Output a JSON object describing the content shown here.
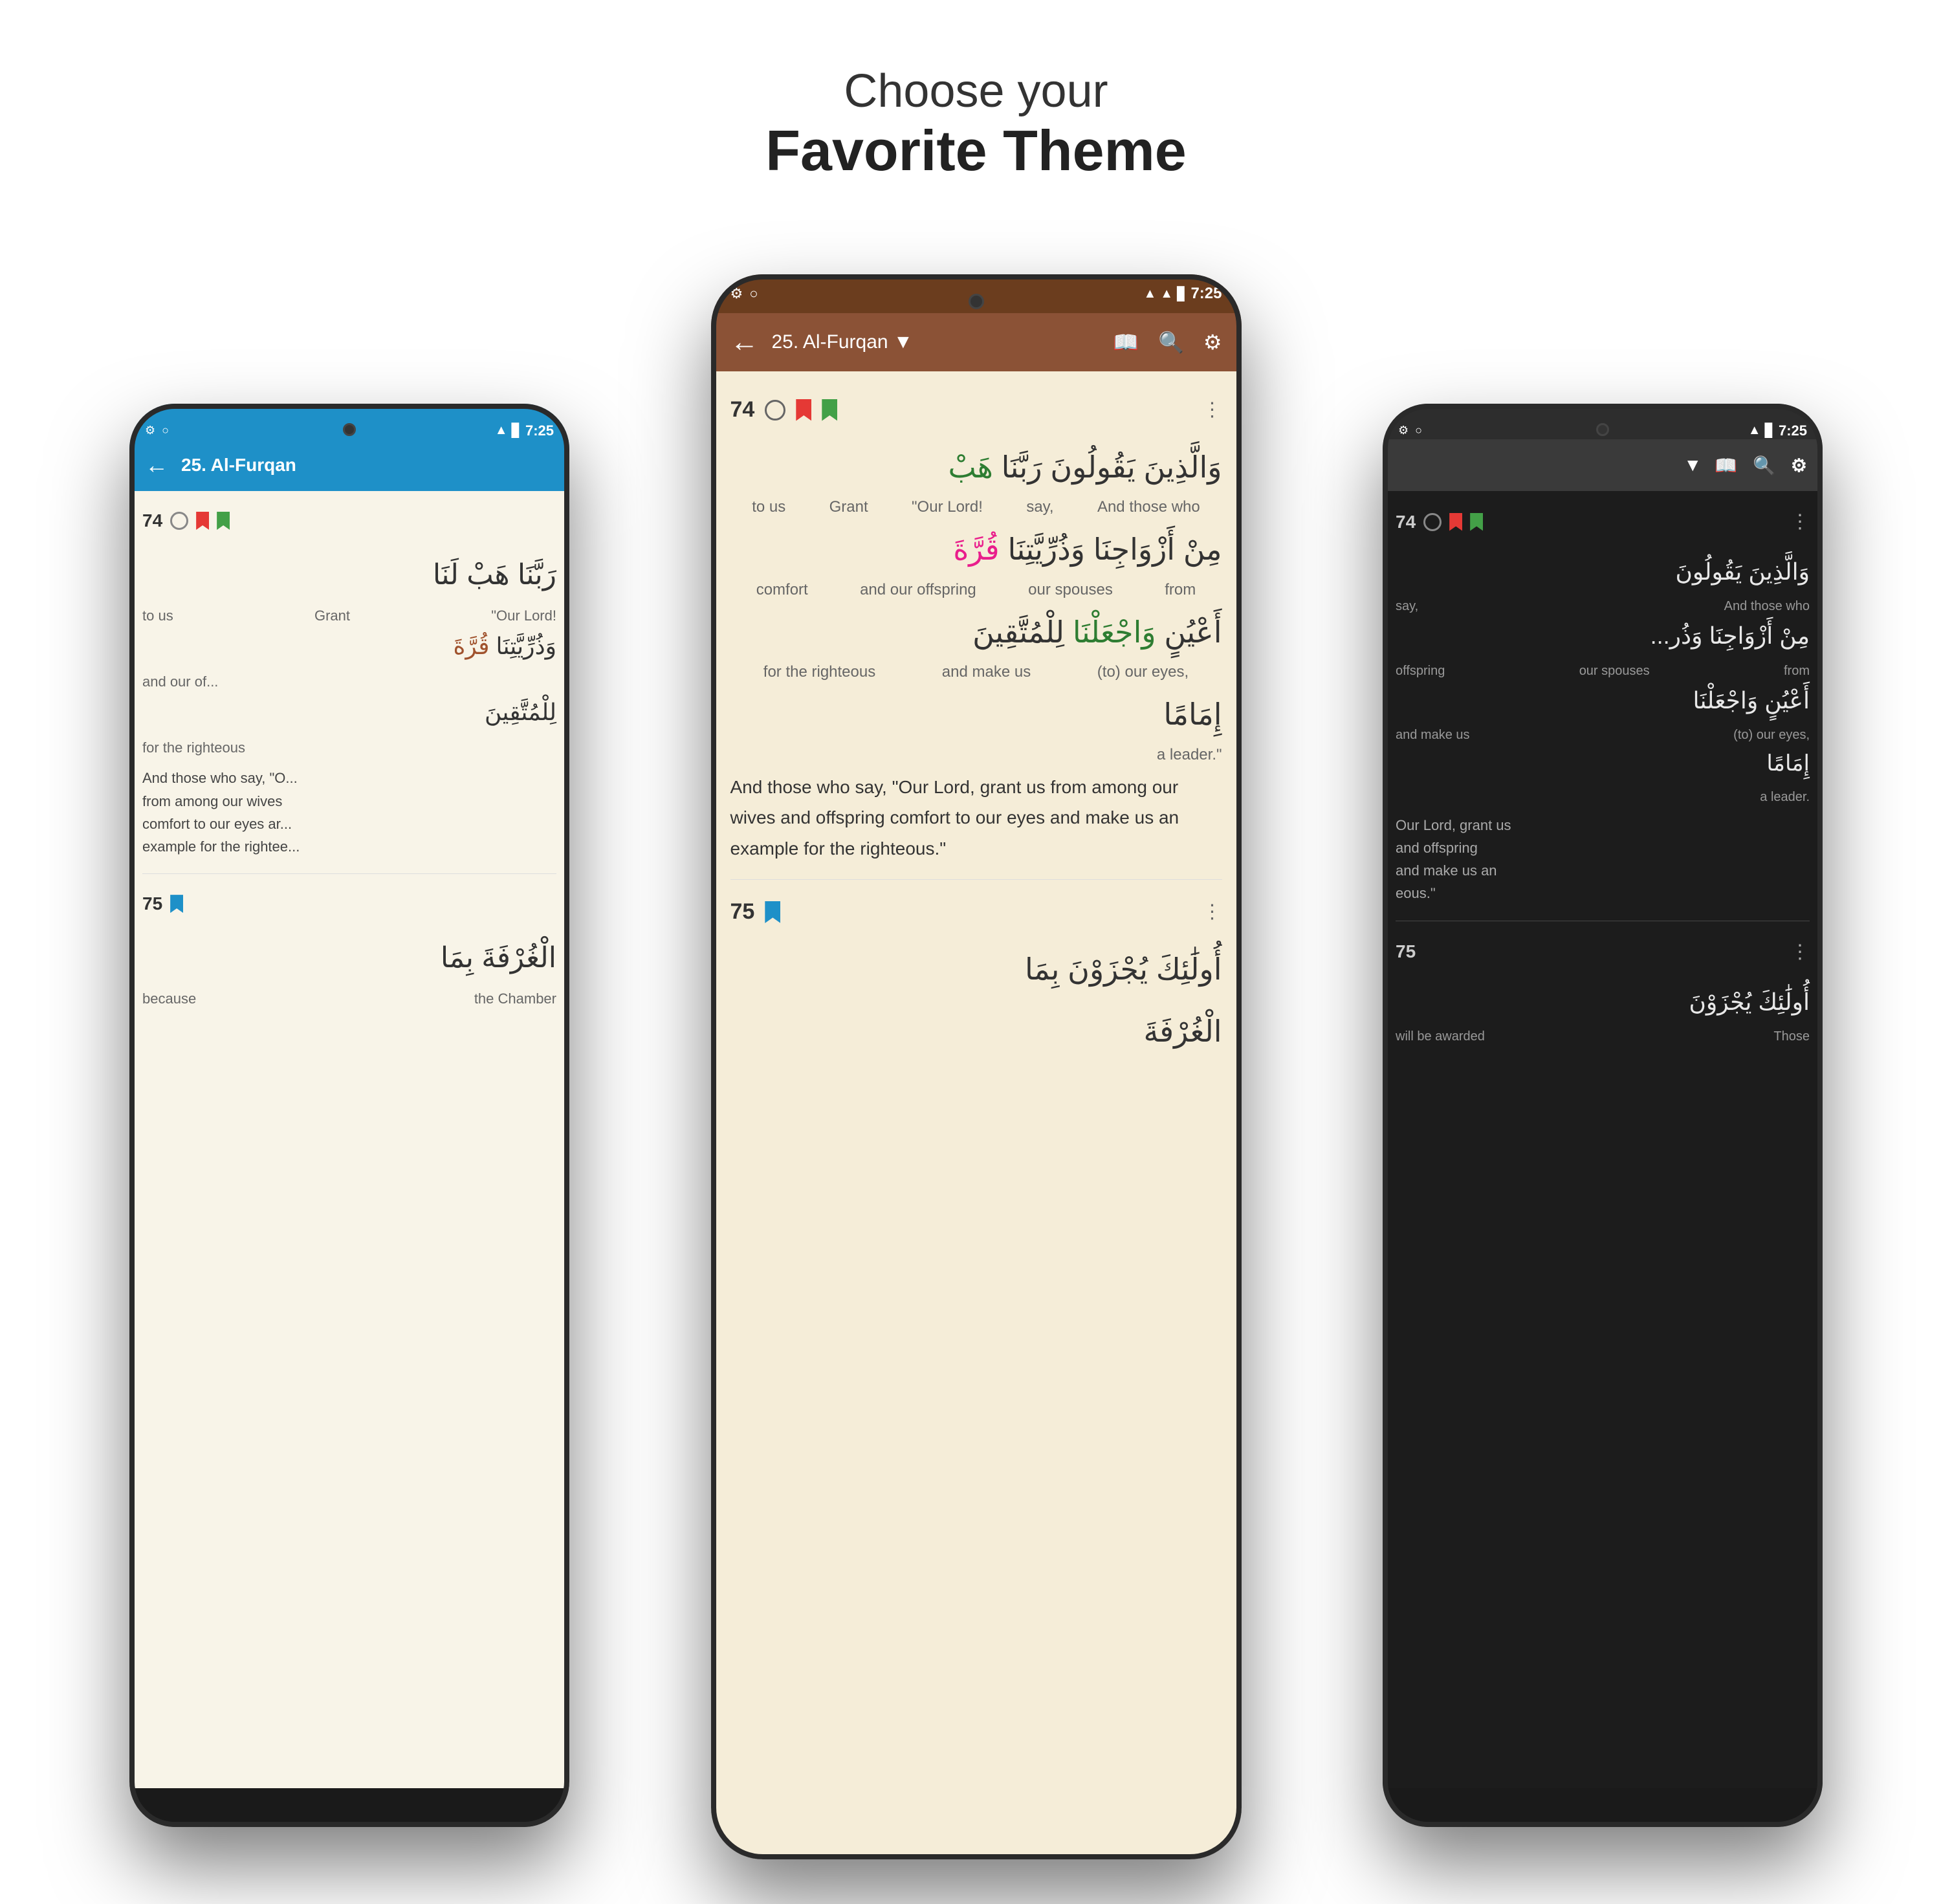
{
  "header": {
    "subtitle": "Choose your",
    "title": "Favorite Theme"
  },
  "phones": {
    "left": {
      "theme": "blue",
      "status_bar": {
        "icons_left": [
          "⚙",
          "○"
        ],
        "time": "7:25"
      },
      "toolbar": {
        "back": "←",
        "title": "25. Al-Furqan",
        "icons": []
      },
      "verse74": {
        "number": "74",
        "arabic_lines": [
          "رَبَّنَا هَبْ لَنَا",
          "to us  Grant  \"Our Lord!",
          "وَذُرِّيَّتِنَا",
          "and our off...",
          "لِلْمُتَّقِينَ",
          "for the righteous"
        ],
        "translation": "And those who say, \"O... from among our wives comfort to our eyes ar... example for the rightee..."
      },
      "verse75": {
        "number": "75",
        "arabic": "الْغُرْفَةَ بِمَا",
        "trans_words": [
          "because",
          "the Chamber"
        ]
      }
    },
    "center": {
      "theme": "brown",
      "status_bar": {
        "icons_left": [
          "⚙",
          "○"
        ],
        "signal": "▲",
        "battery": "▊",
        "time": "7:25"
      },
      "toolbar": {
        "back": "←",
        "title": "25. Al-Furqan ▼",
        "icon_book": "📖",
        "icon_search": "🔍",
        "icon_settings": "⚙"
      },
      "verse74": {
        "number": "74",
        "arabic_line1": "وَالَّذِينَ يَقُولُونَ رَبَّنَا هَبْ",
        "trans_line1": "to us  Grant  \"Our Lord!  say,  And those who",
        "arabic_line2": "مِنْ أَزْوَاجِنَا وَذُرِّيَّتِنَا قُرَّةَ",
        "trans_line2": "comfort  and our offspring  our spouses  from",
        "arabic_line3": "أَعْيُنٍ وَاجْعَلْنَا لِلْمُتَّقِينَ",
        "trans_line3": "for the righteous  and make us  (to) our eyes,",
        "arabic_line4": "إِمَامًا",
        "trans_line4": "a leader.\"",
        "full_translation": "And those who say, \"Our Lord, grant us from among our wives and offspring comfort to our eyes and make us an example for the righteous.\""
      },
      "verse75": {
        "number": "75",
        "arabic_line1": "أُولَٰئِكَ يُجْزَوْنَ بِمَا",
        "arabic_line2": "الْغُرْفَةَ"
      }
    },
    "right": {
      "theme": "dark",
      "status_bar": {
        "signal": "▲",
        "battery": "▊",
        "time": "7:25"
      },
      "toolbar": {
        "title_dropdown": "▼",
        "icon_book": "📖",
        "icon_search": "🔍",
        "icon_settings": "⚙"
      },
      "verse74": {
        "number": "74",
        "arabic_line1": "وَالَّذِينَ يَقُولُونَ",
        "trans1": "say,  And those who",
        "arabic_line2": "مِنْ أَزْوَاجِنَا وَذُر",
        "trans2": "offspring  our spouses  from",
        "arabic_line3": "أَعْيُنٍ وَاجْعَلْنَا",
        "trans3": "and make us  (to) our eyes,",
        "arabic_line4": "إِمَامًا",
        "trans4": "a leader.",
        "translation": "Our Lord, grant us and offspring and make us an eous.\""
      },
      "verse75": {
        "number": "75",
        "arabic_line1": "أُولَٰئِكَ يُجْزَوْنَ",
        "trans1": "will be awarded  Those"
      }
    }
  }
}
